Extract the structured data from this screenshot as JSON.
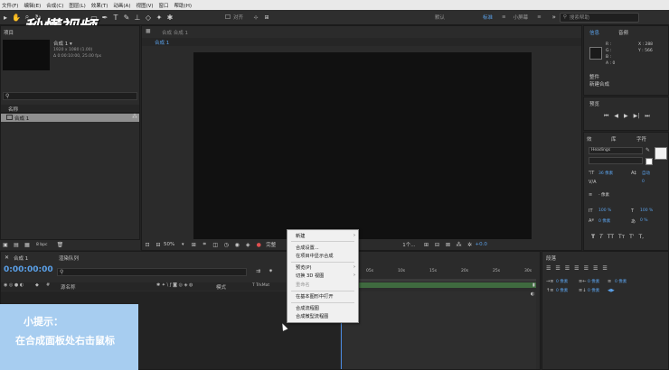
{
  "menubar": {
    "items": [
      "文件(F)",
      "编辑(E)",
      "合成(C)",
      "图层(L)",
      "效果(T)",
      "动画(A)",
      "视图(V)",
      "窗口",
      "帮助(H)"
    ]
  },
  "toolbar": {
    "align_label": "对齐",
    "workspaces": [
      "默认",
      "标准",
      "小屏幕"
    ],
    "search_placeholder": "搜索帮助"
  },
  "watermark": "秒懂视频",
  "project_panel": {
    "tab": "项目",
    "comp_name": "合成 1 ▾",
    "comp_info1": "1920 x 1080 (1.00)",
    "comp_info2": "Δ 0:00:10:00, 25.00 fps",
    "search_icon_glyph": "⚲",
    "column_name": "名称",
    "item_name": "合成 1",
    "bpc": "8 bpc"
  },
  "comp_panel": {
    "header": "合成 合成 1",
    "tab": "合成 1",
    "zoom": "50%",
    "full_label": "完整",
    "views_label": "1个...",
    "exposure": "+0.0"
  },
  "info_panel": {
    "tab_info": "信息",
    "tab_audio": "音频",
    "r": "R :",
    "g": "G :",
    "b": "B :",
    "a": "A : 0",
    "x": "X : 288",
    "y": "Y : 566",
    "status1": "整件",
    "status2": "新建合成"
  },
  "preview_panel": {
    "tab": "预览"
  },
  "effects_panel": {
    "tab1": "效",
    "tab2": "库",
    "tab3": "字符"
  },
  "character_panel": {
    "font": "Headings",
    "size": "36 像素",
    "leading": "自动",
    "tracking": "0",
    "stroke": "- 像素",
    "vert_scale": "100 %",
    "horiz_scale": "100 %",
    "baseline": "0 像素",
    "tsume": "0 %",
    "t_buttons": [
      "T",
      "T",
      "TT",
      "Tт",
      "T'",
      "T,"
    ]
  },
  "timeline": {
    "tab_comp": "合成 1",
    "tab_render": "渲染队列",
    "timecode": "0:00:00:00",
    "col_source": "源名称",
    "col_mode": "模式",
    "col_trkmat": "T TrkMat",
    "col_parent": "父级",
    "ruler": [
      "05s",
      "10s",
      "15s",
      "20s",
      "25s",
      "30s"
    ]
  },
  "paragraph_panel": {
    "tab": "段落",
    "indent1": "0 像素",
    "indent2": "0 像素",
    "indent3": "0 像素",
    "indent4": "0 像素",
    "indent5": "0 像素"
  },
  "context_menu": {
    "items": [
      {
        "label": "新建",
        "submenu": true,
        "disabled": false
      },
      {
        "label": "合成设置...",
        "submenu": false,
        "disabled": false
      },
      {
        "label": "在项目中显示合成",
        "submenu": false,
        "disabled": false
      },
      {
        "label": "预览(P)",
        "submenu": true,
        "disabled": false
      },
      {
        "label": "切换 3D 视图",
        "submenu": true,
        "disabled": false
      },
      {
        "label": "重命名",
        "submenu": false,
        "disabled": true
      },
      {
        "label": "在基本图形中打开",
        "submenu": false,
        "disabled": false
      },
      {
        "label": "合成流程图",
        "submenu": false,
        "disabled": false
      },
      {
        "label": "合成微型流程图",
        "submenu": false,
        "disabled": false
      }
    ],
    "arrow": "›"
  },
  "tip": {
    "title": "小提示：",
    "body": "在合成面板处右击鼠标"
  },
  "colors": {
    "accent": "#5aa0e8",
    "tip_bg": "#a7cdf0",
    "viewer_bg": "#111111"
  }
}
